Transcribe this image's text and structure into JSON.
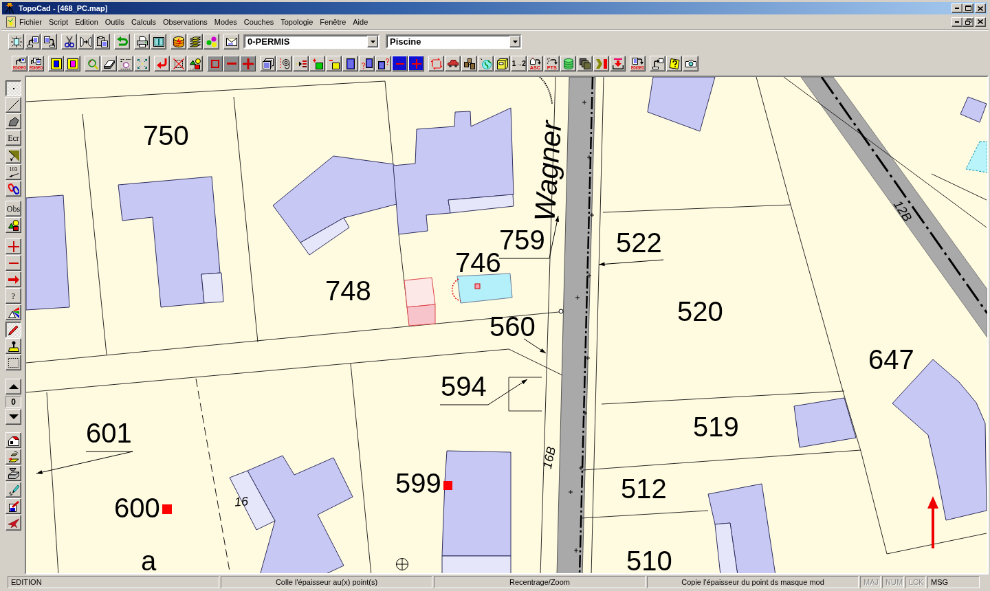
{
  "window": {
    "title": "TopoCad - [468_PC.map]"
  },
  "menu": [
    "Fichier",
    "Script",
    "Edition",
    "Outils",
    "Calculs",
    "Observations",
    "Modes",
    "Couches",
    "Topologie",
    "Fenêtre",
    "Aide"
  ],
  "toolbar_1": {
    "layer": "0-PERMIS",
    "object_type": "Piscine"
  },
  "toolbar_2": {
    "captions": [
      "EDIGEO",
      "EDIGEO",
      "1→2",
      "ASC",
      "PTS",
      "EDIGEO"
    ]
  },
  "left_toolbar": {
    "tool_groups": [
      [
        {
          "selected": true
        },
        {
          "selected": false
        },
        {
          "selected": false
        },
        {
          "label": "Ecr",
          "selected": false
        }
      ],
      [
        {
          "selected": false
        },
        {
          "label": "103",
          "selected": false
        },
        {
          "selected": false
        }
      ],
      [
        {
          "label": "Obs",
          "selected": false
        },
        {
          "selected": false
        }
      ],
      [
        {
          "selected": false
        },
        {
          "selected": false
        },
        {
          "selected": false
        },
        {
          "label": "?",
          "selected": false
        },
        {
          "selected": false
        }
      ],
      [
        {
          "selected": true
        },
        {
          "selected": false
        },
        {
          "selected": false
        }
      ],
      [
        {
          "selected": false
        },
        {
          "selected": false
        },
        {
          "selected": false
        },
        {
          "selected": false
        },
        {
          "selected": false
        },
        {
          "selected": false
        }
      ]
    ],
    "counter": "0"
  },
  "map": {
    "street_name": "Wagner",
    "parcel_numbers": [
      "750",
      "759",
      "522",
      "746",
      "748",
      "520",
      "560",
      "647",
      "594",
      "519",
      "601",
      "599",
      "512",
      "600",
      "510"
    ],
    "labels": [
      "12B",
      "16B",
      "16",
      "a"
    ]
  },
  "status_bar": {
    "panels": [
      "EDITION",
      "Colle l'épaisseur au(x) point(s)",
      "Recentrage/Zoom",
      "Copie l'épaisseur du point ds masque mod"
    ],
    "indicators": [
      {
        "label": "MAJ",
        "on": false
      },
      {
        "label": "NUM",
        "on": false
      },
      {
        "label": "LCK",
        "on": false
      },
      {
        "label": "MSG",
        "on": true
      }
    ]
  }
}
